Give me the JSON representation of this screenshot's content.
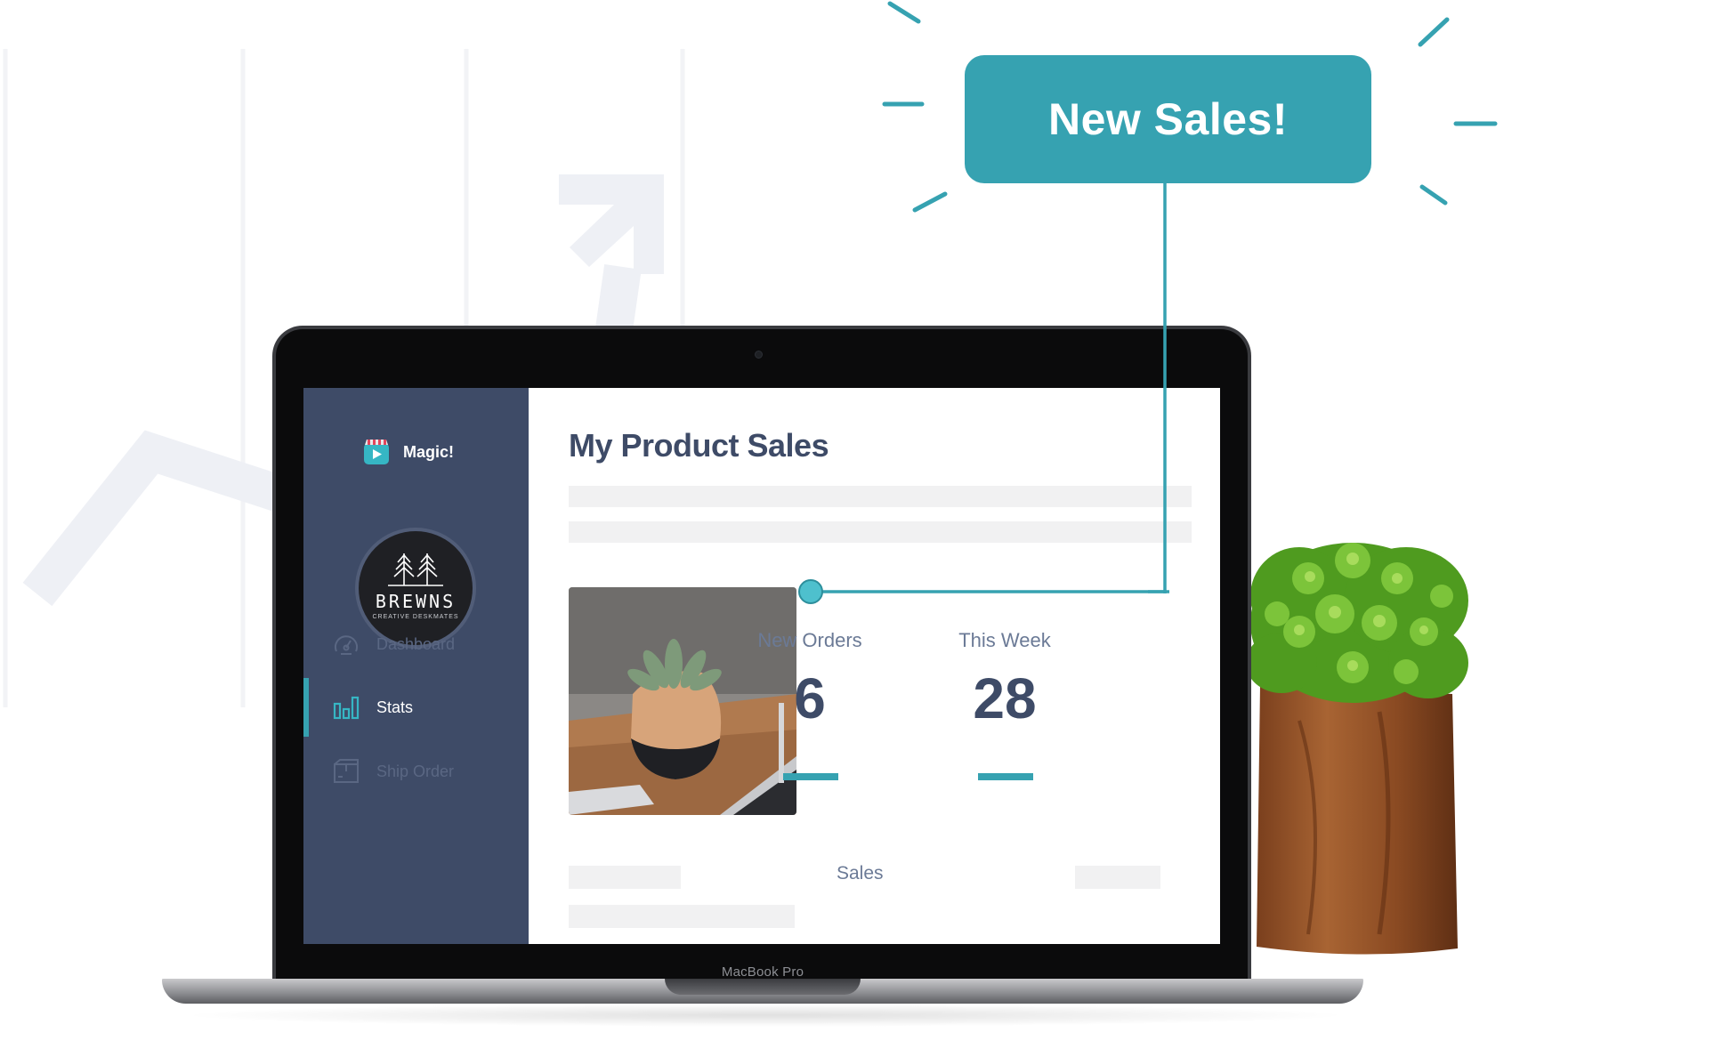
{
  "callout": {
    "text": "New Sales!"
  },
  "laptop": {
    "brand_label": "MacBook Pro"
  },
  "sidebar": {
    "app_name": "Magic!",
    "brand": {
      "title": "BREWNS",
      "subtitle": "CREATIVE DESKMATES"
    },
    "items": [
      {
        "label": "Dashboard",
        "icon": "dashboard-icon",
        "active": false
      },
      {
        "label": "Stats",
        "icon": "bar-chart-icon",
        "active": true
      },
      {
        "label": "Ship Order",
        "icon": "package-icon",
        "active": false
      }
    ]
  },
  "main": {
    "title": "My Product Sales",
    "stats": [
      {
        "label": "New Orders",
        "value": "6"
      },
      {
        "label": "This Week",
        "value": "28"
      }
    ],
    "sales_label": "Sales"
  },
  "colors": {
    "accent": "#36a2b1",
    "sidebar": "#3e4b67",
    "title": "#3e4b67"
  }
}
